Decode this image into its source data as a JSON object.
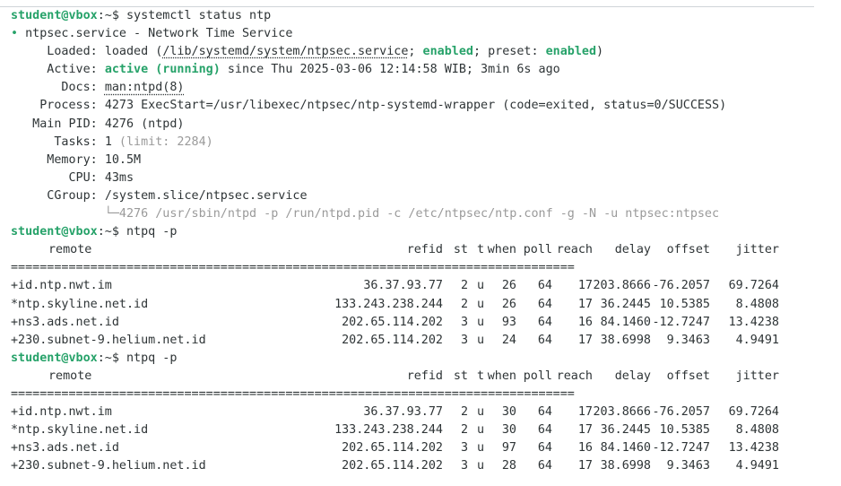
{
  "colors": {
    "prompt": "#26a269",
    "status": "#26a269",
    "dim": "#9a9a9a"
  },
  "prompt": {
    "user_host": "student@vbox",
    "path": ":~$ "
  },
  "cmd1": "systemctl status ntp",
  "svc": {
    "bullet": "•",
    "title": " ntpsec.service - Network Time Service",
    "loaded_label": "     Loaded: ",
    "loaded_pre": "loaded (",
    "loaded_path": "/lib/systemd/system/ntpsec.service",
    "loaded_mid1": "; ",
    "loaded_enabled": "enabled",
    "loaded_mid2": "; preset: ",
    "loaded_preset": "enabled",
    "loaded_post": ")",
    "active_label": "     Active: ",
    "active_state": "active (running)",
    "active_rest": " since Thu 2025-03-06 12:14:58 WIB; 3min 6s ago",
    "docs_label": "       Docs: ",
    "docs_value": "man:ntpd(8)",
    "process_label": "    Process: ",
    "process_value": "4273 ExecStart=/usr/libexec/ntpsec/ntp-systemd-wrapper (code=exited, status=0/SUCCESS)",
    "mainpid_label": "   Main PID: ",
    "mainpid_value": "4276 (ntpd)",
    "tasks_label": "      Tasks: ",
    "tasks_value": "1",
    "tasks_limit": " (limit: 2284)",
    "memory_label": "     Memory: ",
    "memory_value": "10.5M",
    "cpu_label": "        CPU: ",
    "cpu_value": "43ms",
    "cgroup_label": "     CGroup: ",
    "cgroup_value": "/system.slice/ntpsec.service",
    "cgroup_child": "             └─4276 /usr/sbin/ntpd -p /run/ntpd.pid -c /etc/ntpsec/ntp.conf -g -N -u ntpsec:ntpsec"
  },
  "cmd2": "ntpq -p",
  "ntpq_header": {
    "remote": "remote",
    "refid": "refid",
    "st": "st",
    "t": "t",
    "when": "when",
    "poll": "poll",
    "reach": "reach",
    "delay": "delay",
    "offset": "offset",
    "jitter": "jitter"
  },
  "separator": "==============================================================================",
  "table1": [
    {
      "remote": "+id.ntp.nwt.im",
      "refid": "36.37.93.77",
      "st": "2",
      "t": "u",
      "when": "26",
      "poll": "64",
      "reach": "17",
      "delay": "203.8666",
      "offset": "-76.2057",
      "jitter": "69.7264"
    },
    {
      "remote": "*ntp.skyline.net.id",
      "refid": "133.243.238.244",
      "st": "2",
      "t": "u",
      "when": "26",
      "poll": "64",
      "reach": "17",
      "delay": "36.2445",
      "offset": "10.5385",
      "jitter": "8.4808"
    },
    {
      "remote": "+ns3.ads.net.id",
      "refid": "202.65.114.202",
      "st": "3",
      "t": "u",
      "when": "93",
      "poll": "64",
      "reach": "16",
      "delay": "84.1460",
      "offset": "-12.7247",
      "jitter": "13.4238"
    },
    {
      "remote": "+230.subnet-9.helium.net.id",
      "refid": "202.65.114.202",
      "st": "3",
      "t": "u",
      "when": "24",
      "poll": "64",
      "reach": "17",
      "delay": "38.6998",
      "offset": "9.3463",
      "jitter": "4.9491"
    }
  ],
  "cmd3": "ntpq -p",
  "table2": [
    {
      "remote": "+id.ntp.nwt.im",
      "refid": "36.37.93.77",
      "st": "2",
      "t": "u",
      "when": "30",
      "poll": "64",
      "reach": "17",
      "delay": "203.8666",
      "offset": "-76.2057",
      "jitter": "69.7264"
    },
    {
      "remote": "*ntp.skyline.net.id",
      "refid": "133.243.238.244",
      "st": "2",
      "t": "u",
      "when": "30",
      "poll": "64",
      "reach": "17",
      "delay": "36.2445",
      "offset": "10.5385",
      "jitter": "8.4808"
    },
    {
      "remote": "+ns3.ads.net.id",
      "refid": "202.65.114.202",
      "st": "3",
      "t": "u",
      "when": "97",
      "poll": "64",
      "reach": "16",
      "delay": "84.1460",
      "offset": "-12.7247",
      "jitter": "13.4238"
    },
    {
      "remote": "+230.subnet-9.helium.net.id",
      "refid": "202.65.114.202",
      "st": "3",
      "t": "u",
      "when": "28",
      "poll": "64",
      "reach": "17",
      "delay": "38.6998",
      "offset": "9.3463",
      "jitter": "4.9491"
    }
  ]
}
